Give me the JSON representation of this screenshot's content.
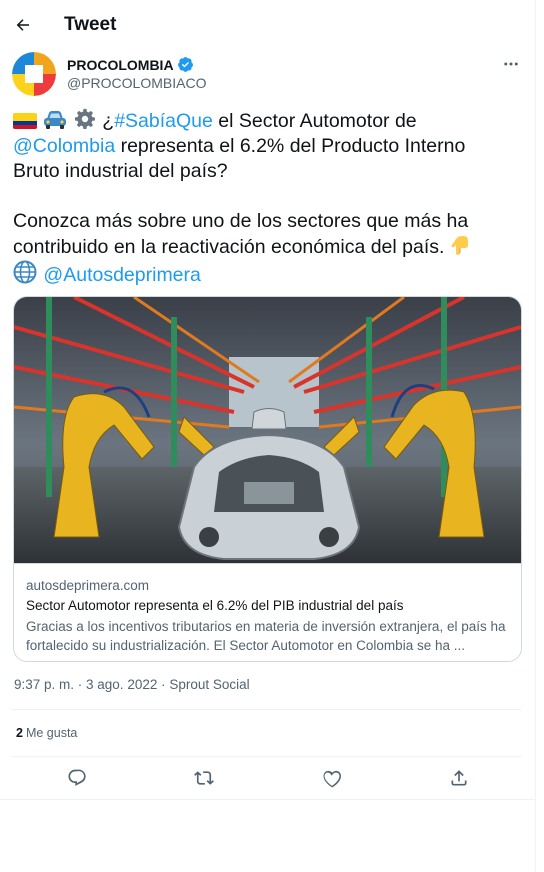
{
  "header": {
    "title": "Tweet",
    "back_icon": "arrow-left-icon"
  },
  "author": {
    "name": "PROCOLOMBIA",
    "handle": "@PROCOLOMBIACO",
    "verified": true,
    "verified_color": "#1d9bf0"
  },
  "tweet": {
    "emoji": [
      "colombia-flag-emoji",
      "car-emoji",
      "gear-emoji"
    ],
    "line1_pre": "¿",
    "hashtag": "#SabíaQue",
    "line1_mid": " el Sector Automotor de",
    "mention_colombia": "@Colombia",
    "line1_post": " representa el 6.2% del Producto Interno Bruto industrial del país?",
    "para2": "Conozca más sobre uno de los sectores que más ha contribuido en la reactivación económica del país. ",
    "pointing_emoji": "hand-pointing-down-emoji",
    "globe_emoji": "globe-emoji",
    "mention_autos": "@Autosdeprimera",
    "link_color": "#1d9bf0"
  },
  "card": {
    "image": "car-factory-assembly-line-photo",
    "domain": "autosdeprimera.com",
    "title": "Sector Automotor representa el 6.2% del PIB industrial del país",
    "description": "Gracias a los incentivos tributarios en materia de inversión extranjera, el país ha fortalecido su industrialización. El Sector Automotor en Colombia se ha ..."
  },
  "meta": {
    "timestamp": "9:37 p. m. · 3 ago. 2022 · Sprout Social"
  },
  "stats": {
    "likes_count": "2",
    "likes_label": "Me gusta"
  },
  "actions": [
    "reply-icon",
    "retweet-icon",
    "like-icon",
    "share-icon"
  ]
}
